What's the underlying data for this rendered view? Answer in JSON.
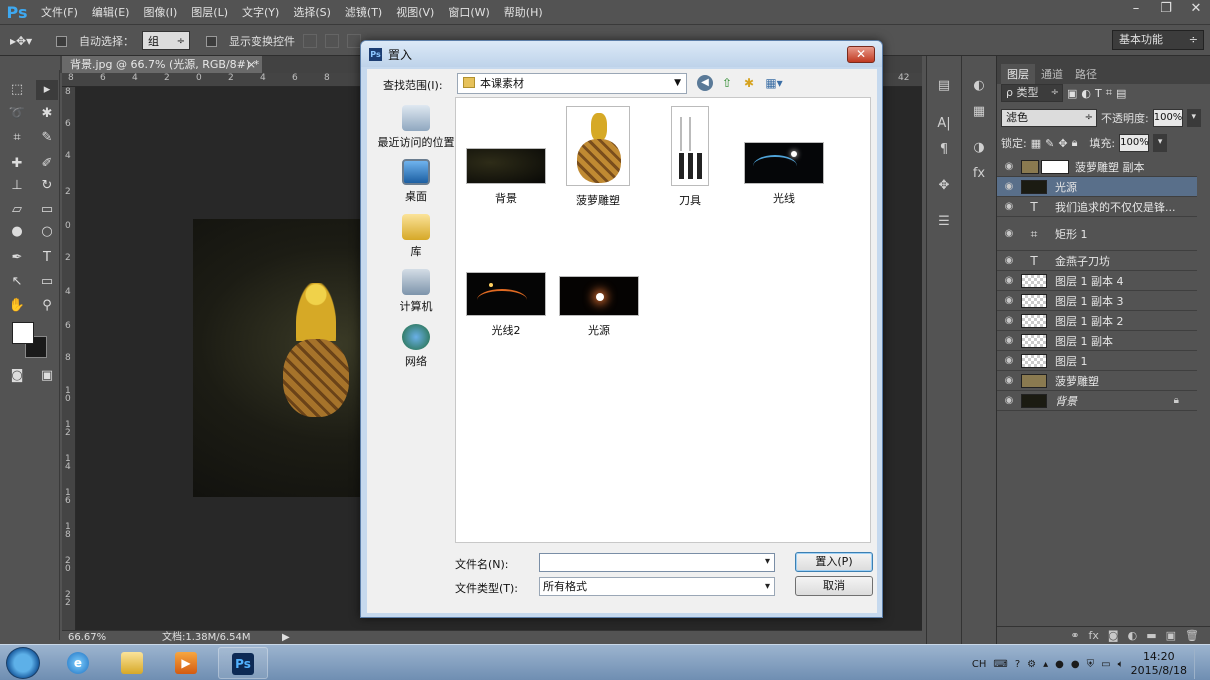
{
  "app": {
    "logo": "Ps",
    "menu": [
      "文件(F)",
      "编辑(E)",
      "图像(I)",
      "图层(L)",
      "文字(Y)",
      "选择(S)",
      "滤镜(T)",
      "视图(V)",
      "窗口(W)",
      "帮助(H)"
    ],
    "window_controls": [
      "–",
      "❐",
      "✕"
    ]
  },
  "options_bar": {
    "auto_select_label": "自动选择：",
    "auto_select_value": "组",
    "show_transform_label": "显示变换控件",
    "workspace": "基本功能"
  },
  "document": {
    "tab_title": "背景.jpg @ 66.7% (光源, RGB/8#) *",
    "zoom": "66.67%",
    "doc_info": "文档:1.38M/6.54M",
    "ruler_h": [
      "8",
      "6",
      "4",
      "2",
      "0",
      "2",
      "4",
      "6",
      "8",
      "42"
    ],
    "ruler_v": [
      "8",
      "6",
      "4",
      "2",
      "0",
      "2",
      "4",
      "6",
      "8",
      "1 0",
      "1 2",
      "1 4",
      "1 6",
      "1 8",
      "2 0",
      "2 2"
    ]
  },
  "layers_panel": {
    "tabs": [
      "图层",
      "通道",
      "路径"
    ],
    "filter_label": "ρ 类型",
    "blend_mode": "滤色",
    "opacity_label": "不透明度:",
    "opacity_value": "100%",
    "lock_label": "锁定:",
    "fill_label": "填充:",
    "fill_value": "100%",
    "layers": [
      {
        "name": "菠萝雕塑 副本",
        "thumb": "photo",
        "selected": false
      },
      {
        "name": "光源",
        "thumb": "dark",
        "selected": true
      },
      {
        "name": "我们追求的不仅仅是锋...",
        "thumb": "text",
        "selected": false
      },
      {
        "name": "矩形 1",
        "thumb": "shape",
        "selected": false
      },
      {
        "name": "金燕子刀坊",
        "thumb": "text",
        "selected": false
      },
      {
        "name": "图层 1 副本 4",
        "thumb": "checker",
        "selected": false
      },
      {
        "name": "图层 1 副本 3",
        "thumb": "checker",
        "selected": false
      },
      {
        "name": "图层 1 副本 2",
        "thumb": "checker",
        "selected": false
      },
      {
        "name": "图层 1 副本",
        "thumb": "checker",
        "selected": false
      },
      {
        "name": "图层 1",
        "thumb": "checker",
        "selected": false
      },
      {
        "name": "菠萝雕塑",
        "thumb": "photo",
        "selected": false
      },
      {
        "name": "背景",
        "thumb": "dark",
        "selected": false
      }
    ]
  },
  "dialog": {
    "title": "置入",
    "look_in_label": "查找范围(I):",
    "look_in_value": "本课素材",
    "places": [
      "最近访问的位置",
      "桌面",
      "库",
      "计算机",
      "网络"
    ],
    "files": [
      "背景",
      "菠萝雕塑",
      "刀具",
      "光线",
      "光线2",
      "光源"
    ],
    "file_name_label": "文件名(N):",
    "file_name_value": "",
    "file_type_label": "文件类型(T):",
    "file_type_value": "所有格式",
    "place_button": "置入(P)",
    "cancel_button": "取消"
  },
  "taskbar": {
    "photoshop_label": "Ps",
    "lang": "CH",
    "time": "14:20",
    "date": "2015/8/18"
  },
  "colors": {
    "ps_dark": "#535353",
    "selected_layer": "#596f8a",
    "dialog_frame": "#c6d9ee",
    "taskbar": "#7f9cbf"
  }
}
